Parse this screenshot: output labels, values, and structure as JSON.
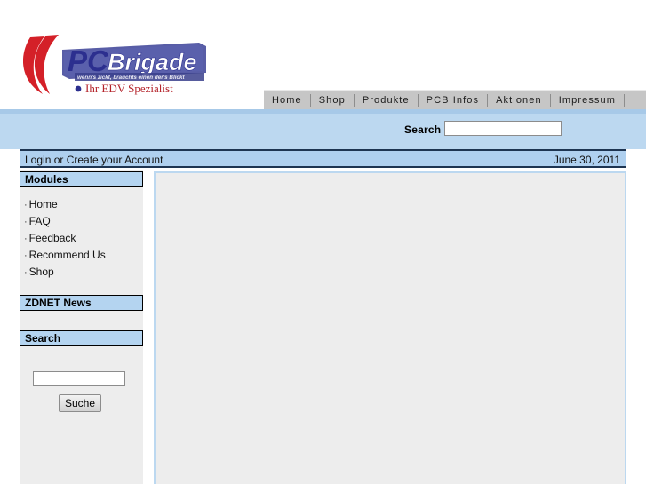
{
  "site": {
    "logo": {
      "brand_pc": "PC",
      "brand_brigade": "Brigade",
      "slogan": "wenn's zickt, brauchts einen der's Blickt",
      "tagline": "Ihr EDV Spezialist",
      "colors": {
        "swoosh_red": "#d42028",
        "brand_blue": "#2c2f8f",
        "tagline_red": "#b4232a"
      }
    }
  },
  "topnav": {
    "items": [
      {
        "label": "Home"
      },
      {
        "label": "Shop"
      },
      {
        "label": "Produkte"
      },
      {
        "label": "PCB Infos"
      },
      {
        "label": "Aktionen"
      },
      {
        "label": "Impressum"
      }
    ]
  },
  "header_search": {
    "label": "Search",
    "value": "",
    "placeholder": ""
  },
  "account_bar": {
    "login_text": "Login or Create your Account",
    "date": "June 30, 2011"
  },
  "sidebar": {
    "modules": {
      "title": "Modules",
      "items": [
        {
          "label": "Home"
        },
        {
          "label": "FAQ"
        },
        {
          "label": "Feedback"
        },
        {
          "label": "Recommend Us"
        },
        {
          "label": "Shop"
        }
      ]
    },
    "zdnet": {
      "title": "ZDNET News"
    },
    "search": {
      "title": "Search",
      "value": "",
      "placeholder": "",
      "button_label": "Suche"
    }
  },
  "content": {
    "body_text": ""
  },
  "colors": {
    "band_blue": "#bcd8f0",
    "band_blue_dark": "#a7c9e8",
    "login_blue": "#afd0ef",
    "block_title_blue": "#b4d4f0",
    "nav_gray": "#c6c6c6",
    "panel_gray": "#ededed",
    "rule_dark": "#1e3552"
  }
}
